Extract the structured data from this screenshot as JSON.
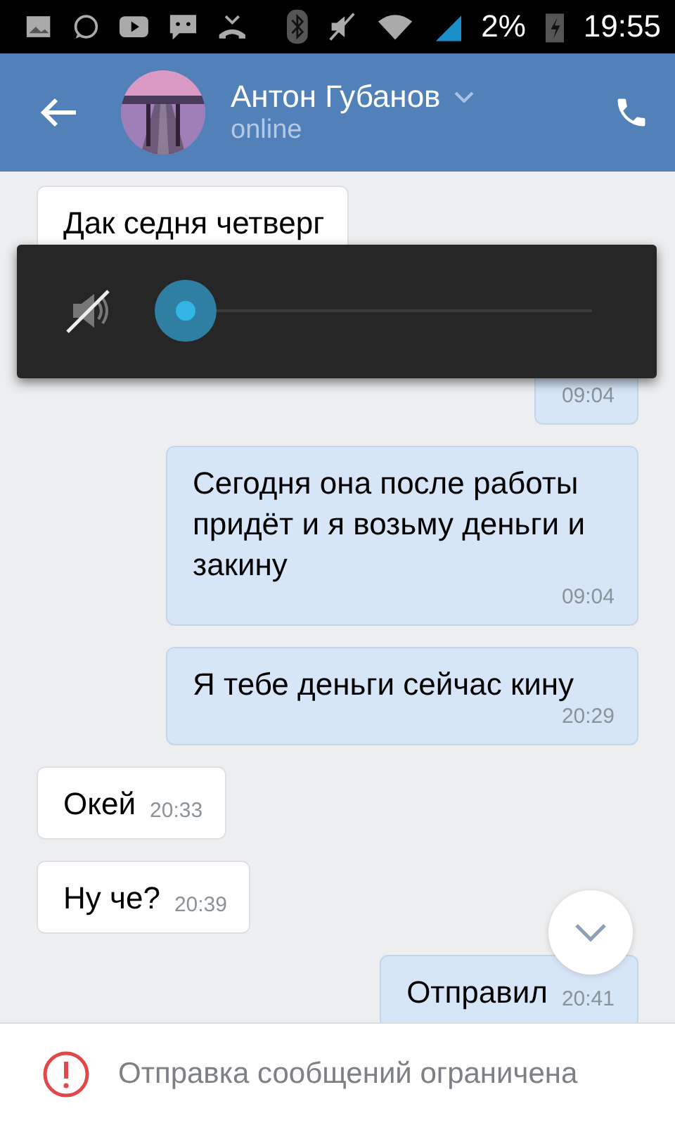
{
  "status_bar": {
    "battery": "2%",
    "time": "19:55"
  },
  "header": {
    "name": "Антон Губанов",
    "status": "online"
  },
  "messages": [
    {
      "kind": "incoming",
      "text": "Дак седня четверг"
    },
    {
      "kind": "outgoing",
      "time": "09:04"
    },
    {
      "kind": "outgoing",
      "text": "Сегодня она после работы придёт и я возьму деньги и закину",
      "time": "09:04"
    },
    {
      "kind": "outgoing",
      "text": "Я тебе деньги сейчас кину",
      "time": "20:29"
    },
    {
      "kind": "incoming",
      "text": "Окей",
      "time": "20:33"
    },
    {
      "kind": "incoming",
      "text": "Ну че?",
      "time": "20:39"
    },
    {
      "kind": "outgoing",
      "text": "Отправил",
      "time": "20:41"
    }
  ],
  "volume_popup": {
    "muted": true
  },
  "footer": {
    "notice": "Отправка сообщений ограничена"
  }
}
